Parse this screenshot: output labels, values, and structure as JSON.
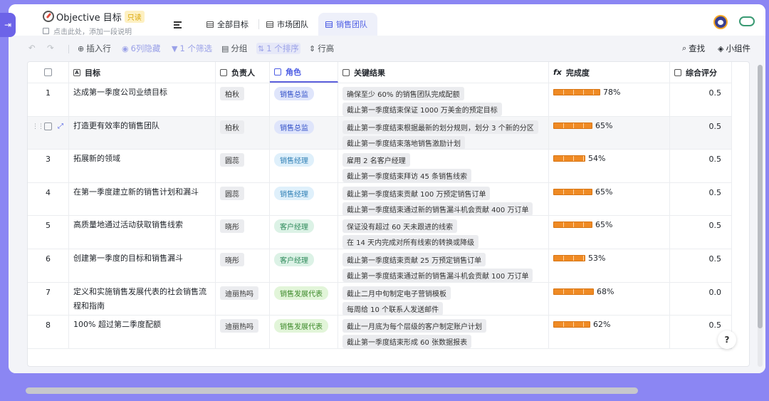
{
  "header": {
    "title": "Objective 目标",
    "readonly_badge": "只读",
    "description": "点击此处，添加一段说明",
    "tabs": [
      {
        "label": "全部目标",
        "active": false
      },
      {
        "label": "市场团队",
        "active": false
      },
      {
        "label": "销售团队",
        "active": true
      }
    ]
  },
  "toolbar": {
    "insert_row": "插入行",
    "hidden": "6列隐藏",
    "filter": "1 个筛选",
    "group": "分组",
    "sort": "1 个排序",
    "row_height": "行高",
    "find": "查找",
    "widgets": "小组件"
  },
  "columns": {
    "goal": "目标",
    "owner": "负责人",
    "role": "角色",
    "key_results": "关键结果",
    "completion": "完成度",
    "score": "综合评分"
  },
  "colors": {
    "accent": "#4e5ee4",
    "progress": "#ef8a24",
    "background": "#8b86f3"
  },
  "rows": [
    {
      "num": "1",
      "goal": "达成第一季度公司业绩目标",
      "owner": "柏秋",
      "role": "销售总监",
      "role_color": "#dfe5fb",
      "role_text": "#3250c8",
      "kr": [
        "确保至少 60% 的销售团队完成配额",
        "截止第一季度结束保证 1000 万美金的预定目标"
      ],
      "progress": 78,
      "progress_label": "78%",
      "score": "0.5"
    },
    {
      "num": "",
      "goal": "打造更有效率的销售团队",
      "owner": "柏秋",
      "role": "销售总监",
      "role_color": "#dfe5fb",
      "role_text": "#3250c8",
      "kr": [
        "截止第一季度结束根据最新的划分规则，划分 3 个新的分区",
        "截止第一季度结束落地销售激励计划"
      ],
      "progress": 65,
      "progress_label": "65%",
      "score": "0.5"
    },
    {
      "num": "3",
      "goal": "拓展新的领域",
      "owner": "圆蕊",
      "role": "销售经理",
      "role_color": "#dff0fb",
      "role_text": "#2f7fb5",
      "kr": [
        "雇用 2 名客户经理",
        "截止第一季度结束拜访 45 条销售线索"
      ],
      "progress": 54,
      "progress_label": "54%",
      "score": "0.5"
    },
    {
      "num": "4",
      "goal": "在第一季度建立新的销售计划和漏斗",
      "owner": "圆蕊",
      "role": "销售经理",
      "role_color": "#dff0fb",
      "role_text": "#2f7fb5",
      "kr": [
        "截止第一季度结束贡献 100 万预定销售订单",
        "截止第一季度结束通过新的销售漏斗机会贡献 400 万订单"
      ],
      "progress": 65,
      "progress_label": "65%",
      "score": "0.5"
    },
    {
      "num": "5",
      "goal": "高质量地通过活动获取销售线索",
      "owner": "晓彤",
      "role": "客户经理",
      "role_color": "#dcf2e6",
      "role_text": "#2e8a5a",
      "kr": [
        "保证没有超过 60 天未跟进的线索",
        "在 14 天内完成对所有线索的转换或降级"
      ],
      "progress": 65,
      "progress_label": "65%",
      "score": "0.5"
    },
    {
      "num": "6",
      "goal": "创建第一季度的目标和销售漏斗",
      "owner": "晓彤",
      "role": "客户经理",
      "role_color": "#dcf2e6",
      "role_text": "#2e8a5a",
      "kr": [
        "截止第一季度结束贡献 25 万预定销售订单",
        "截止第一季度结束通过新的销售漏斗机会贡献 100 万订单"
      ],
      "progress": 53,
      "progress_label": "53%",
      "score": "0.5"
    },
    {
      "num": "7",
      "goal": "定义和实施销售发展代表的社会销售流程和指南",
      "owner": "迪丽热吗",
      "role": "销售发展代表",
      "role_color": "#e2f5d9",
      "role_text": "#3d8a2a",
      "kr": [
        "截止二月中旬制定电子营销模板",
        "每周给 10 个联系人发送邮件"
      ],
      "progress": 68,
      "progress_label": "68%",
      "score": "0.0"
    },
    {
      "num": "8",
      "goal": "100% 超过第二季度配额",
      "owner": "迪丽热吗",
      "role": "销售发展代表",
      "role_color": "#e2f5d9",
      "role_text": "#3d8a2a",
      "kr": [
        "截止一月底为每个层级的客户制定账户计划",
        "截止第一季度结束形成 60 张数据报表"
      ],
      "progress": 62,
      "progress_label": "62%",
      "score": "0.5"
    }
  ],
  "help": "?"
}
